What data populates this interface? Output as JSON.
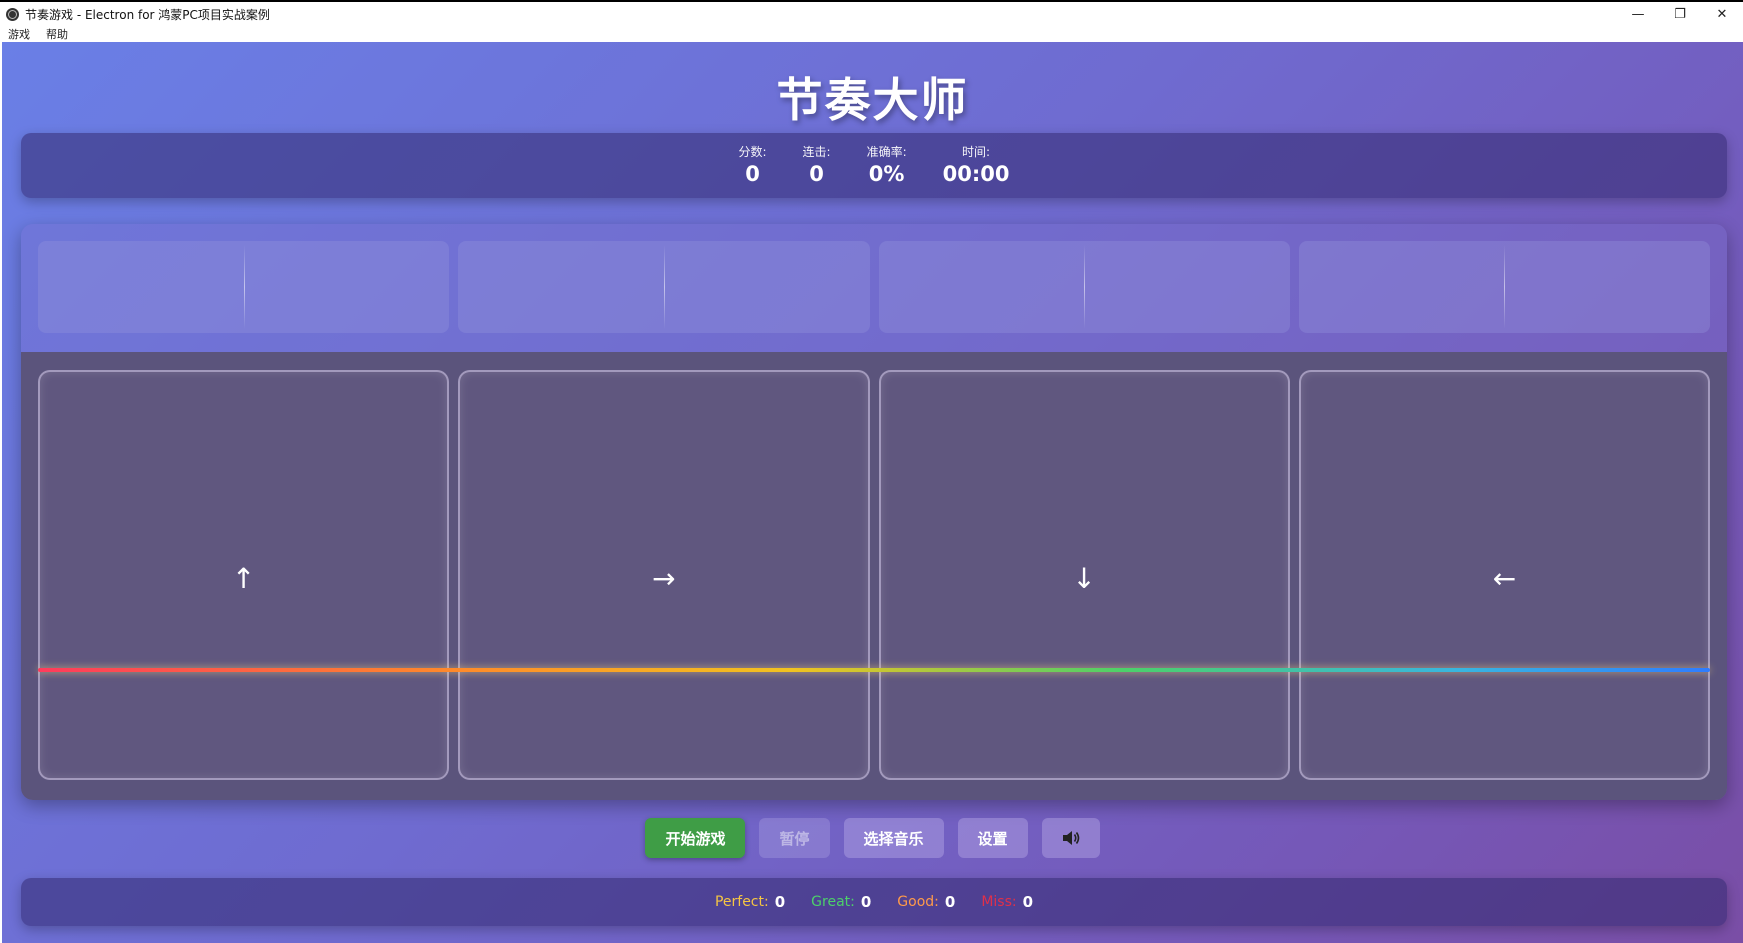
{
  "window": {
    "title": "节奏游戏 - Electron for 鸿蒙PC项目实战案例",
    "controls": {
      "minimize": "—",
      "restore": "❐",
      "close": "✕"
    }
  },
  "menu": [
    "游戏",
    "帮助"
  ],
  "game": {
    "title": "节奏大师"
  },
  "stats": [
    {
      "label": "分数:",
      "value": "0"
    },
    {
      "label": "连击:",
      "value": "0"
    },
    {
      "label": "准确率:",
      "value": "0%"
    },
    {
      "label": "时间:",
      "value": "00:00"
    }
  ],
  "lanes": [
    {
      "arrow": "↑",
      "icon": "arrow-up-icon"
    },
    {
      "arrow": "→",
      "icon": "arrow-right-icon"
    },
    {
      "arrow": "↓",
      "icon": "arrow-down-icon"
    },
    {
      "arrow": "←",
      "icon": "arrow-left-icon"
    }
  ],
  "controls": {
    "start": "开始游戏",
    "pause": "暂停",
    "music": "选择音乐",
    "settings": "设置",
    "sound_icon": "speaker-icon"
  },
  "judgments": [
    {
      "label": "Perfect:",
      "value": "0",
      "color": "#f5c542"
    },
    {
      "label": "Great:",
      "value": "0",
      "color": "#4cd06a"
    },
    {
      "label": "Good:",
      "value": "0",
      "color": "#ff9a4a"
    },
    {
      "label": "Miss:",
      "value": "0",
      "color": "#e0304a"
    }
  ],
  "colors": {
    "start_button": "#3f9d46",
    "judge_line": [
      "#ff3b5c",
      "#ff8a2a",
      "#f2c21f",
      "#4cd06a",
      "#39b5e0",
      "#2f7cff"
    ]
  }
}
